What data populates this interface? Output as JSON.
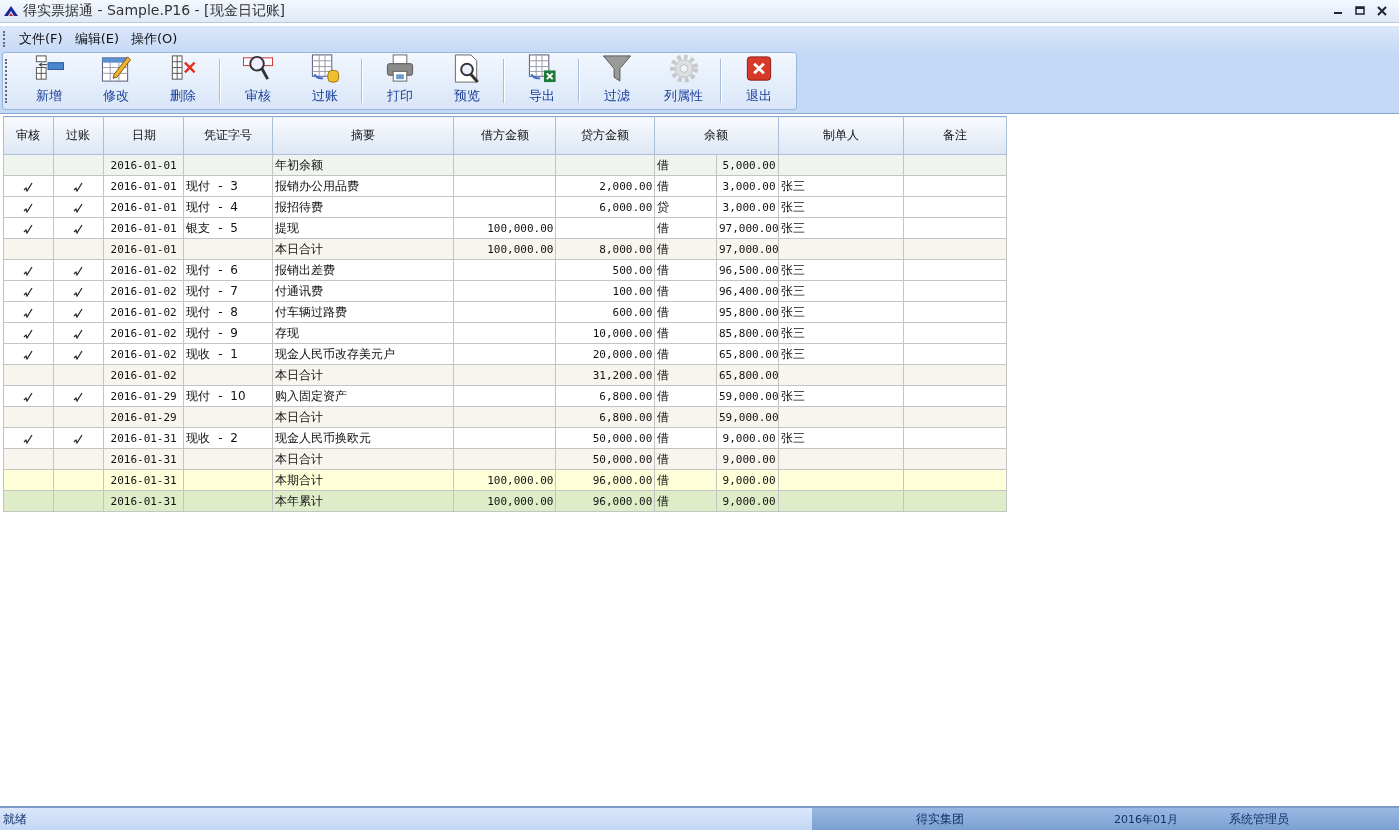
{
  "window": {
    "title": "得实票据通 - Sample.P16 - [现金日记账]"
  },
  "menu": [
    {
      "label": "文件(F)"
    },
    {
      "label": "编辑(E)"
    },
    {
      "label": "操作(O)"
    }
  ],
  "toolbar": [
    {
      "label": "新增",
      "disabled": false
    },
    {
      "label": "修改",
      "disabled": false
    },
    {
      "label": "删除",
      "disabled": false
    },
    {
      "label": "审核",
      "disabled": false
    },
    {
      "label": "过账",
      "disabled": false
    },
    {
      "label": "打印",
      "disabled": false
    },
    {
      "label": "预览",
      "disabled": false
    },
    {
      "label": "导出",
      "disabled": false
    },
    {
      "label": "过滤",
      "disabled": false
    },
    {
      "label": "列属性",
      "disabled": true
    },
    {
      "label": "退出",
      "disabled": false
    }
  ],
  "table": {
    "columns": [
      "审核",
      "过账",
      "日期",
      "凭证字号",
      "摘要",
      "借方金额",
      "贷方金额",
      "余额",
      "制单人",
      "备注"
    ],
    "rows": [
      {
        "kind": "opening",
        "audited": false,
        "posted": false,
        "date": "2016-01-01",
        "summary": "年初余额",
        "direction": "借",
        "balance": "5,000.00"
      },
      {
        "kind": "entry",
        "audited": true,
        "posted": true,
        "date": "2016-01-01",
        "voucher": "现付 - 3",
        "summary": "报销办公用品费",
        "credit": "2,000.00",
        "direction": "借",
        "balance": "3,000.00",
        "maker": "张三"
      },
      {
        "kind": "entry",
        "audited": true,
        "posted": true,
        "date": "2016-01-01",
        "voucher": "现付 - 4",
        "summary": "报招待费",
        "credit": "6,000.00",
        "direction": "贷",
        "balance": "3,000.00",
        "maker": "张三"
      },
      {
        "kind": "entry",
        "audited": true,
        "posted": true,
        "date": "2016-01-01",
        "voucher": "银支 - 5",
        "summary": "提现",
        "debit": "100,000.00",
        "direction": "借",
        "balance": "97,000.00",
        "maker": "张三"
      },
      {
        "kind": "daily",
        "audited": false,
        "posted": false,
        "date": "2016-01-01",
        "summary": "本日合计",
        "debit": "100,000.00",
        "credit": "8,000.00",
        "direction": "借",
        "balance": "97,000.00"
      },
      {
        "kind": "entry",
        "audited": true,
        "posted": true,
        "date": "2016-01-02",
        "voucher": "现付 - 6",
        "summary": "报销出差费",
        "credit": "500.00",
        "direction": "借",
        "balance": "96,500.00",
        "maker": "张三"
      },
      {
        "kind": "entry",
        "audited": true,
        "posted": true,
        "date": "2016-01-02",
        "voucher": "现付 - 7",
        "summary": "付通讯费",
        "credit": "100.00",
        "direction": "借",
        "balance": "96,400.00",
        "maker": "张三"
      },
      {
        "kind": "entry",
        "audited": true,
        "posted": true,
        "date": "2016-01-02",
        "voucher": "现付 - 8",
        "summary": "付车辆过路费",
        "credit": "600.00",
        "direction": "借",
        "balance": "95,800.00",
        "maker": "张三"
      },
      {
        "kind": "entry",
        "audited": true,
        "posted": true,
        "date": "2016-01-02",
        "voucher": "现付 - 9",
        "summary": "存现",
        "credit": "10,000.00",
        "direction": "借",
        "balance": "85,800.00",
        "maker": "张三"
      },
      {
        "kind": "entry",
        "audited": true,
        "posted": true,
        "date": "2016-01-02",
        "voucher": "现收 - 1",
        "summary": "现金人民币改存美元户",
        "credit": "20,000.00",
        "direction": "借",
        "balance": "65,800.00",
        "maker": "张三"
      },
      {
        "kind": "daily",
        "audited": false,
        "posted": false,
        "date": "2016-01-02",
        "summary": "本日合计",
        "credit": "31,200.00",
        "direction": "借",
        "balance": "65,800.00"
      },
      {
        "kind": "entry",
        "audited": true,
        "posted": true,
        "date": "2016-01-29",
        "voucher": "现付 - 10",
        "summary": "购入固定资产",
        "credit": "6,800.00",
        "direction": "借",
        "balance": "59,000.00",
        "maker": "张三"
      },
      {
        "kind": "daily",
        "audited": false,
        "posted": false,
        "date": "2016-01-29",
        "summary": "本日合计",
        "credit": "6,800.00",
        "direction": "借",
        "balance": "59,000.00"
      },
      {
        "kind": "entry",
        "audited": true,
        "posted": true,
        "date": "2016-01-31",
        "voucher": "现收 - 2",
        "summary": "现金人民币换欧元",
        "credit": "50,000.00",
        "direction": "借",
        "balance": "9,000.00",
        "maker": "张三"
      },
      {
        "kind": "daily",
        "audited": false,
        "posted": false,
        "date": "2016-01-31",
        "summary": "本日合计",
        "credit": "50,000.00",
        "direction": "借",
        "balance": "9,000.00"
      },
      {
        "kind": "period",
        "audited": false,
        "posted": false,
        "date": "2016-01-31",
        "summary": "本期合计",
        "debit": "100,000.00",
        "credit": "96,000.00",
        "direction": "借",
        "balance": "9,000.00"
      },
      {
        "kind": "year",
        "audited": false,
        "posted": false,
        "date": "2016-01-31",
        "summary": "本年累计",
        "debit": "100,000.00",
        "credit": "96,000.00",
        "direction": "借",
        "balance": "9,000.00"
      }
    ]
  },
  "status_bar": {
    "message": "就绪",
    "company": "得实集团",
    "period": "2016年01月",
    "user": "系统管理员"
  }
}
